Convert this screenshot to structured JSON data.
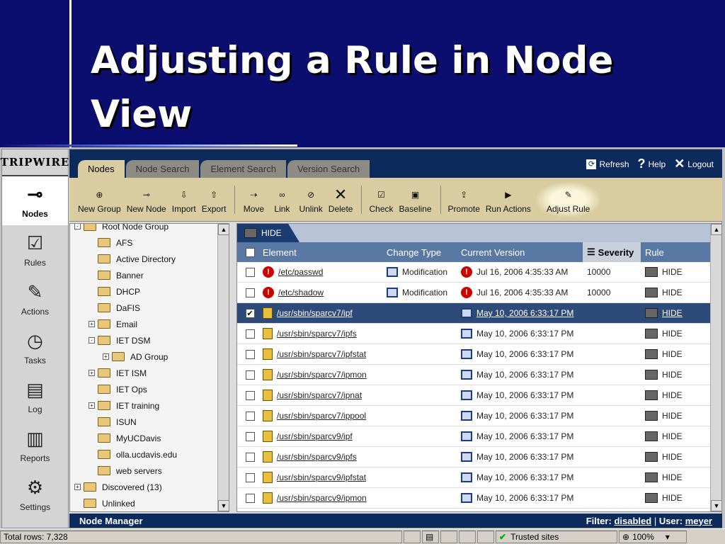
{
  "slide": {
    "title_line1": "Adjusting a Rule in Node",
    "title_line2": "View"
  },
  "app": {
    "brand": "TRIPWIRE",
    "rail": [
      {
        "label": "Nodes",
        "icon": "nodes-icon",
        "active": true
      },
      {
        "label": "Rules",
        "icon": "rules-icon"
      },
      {
        "label": "Actions",
        "icon": "actions-icon"
      },
      {
        "label": "Tasks",
        "icon": "tasks-icon"
      },
      {
        "label": "Log",
        "icon": "log-icon"
      },
      {
        "label": "Reports",
        "icon": "reports-icon"
      },
      {
        "label": "Settings",
        "icon": "settings-icon"
      }
    ],
    "tabs": [
      "Nodes",
      "Node Search",
      "Element Search",
      "Version Search"
    ],
    "toplinks": {
      "refresh": "Refresh",
      "help": "Help",
      "logout": "Logout"
    },
    "toolbar": {
      "new_group": "New Group",
      "new_node": "New Node",
      "import": "Import",
      "export": "Export",
      "move": "Move",
      "link": "Link",
      "unlink": "Unlink",
      "delete": "Delete",
      "check": "Check",
      "baseline": "Baseline",
      "promote": "Promote",
      "run_actions": "Run Actions",
      "adjust_rule": "Adjust Rule"
    },
    "tree": {
      "root": "Root Node Group",
      "items": [
        {
          "label": "AFS",
          "indent": 1
        },
        {
          "label": "Active Directory",
          "indent": 1
        },
        {
          "label": "Banner",
          "indent": 1
        },
        {
          "label": "DHCP",
          "indent": 1
        },
        {
          "label": "DaFIS",
          "indent": 1
        },
        {
          "label": "Email",
          "indent": 1,
          "expander": "+"
        },
        {
          "label": "IET DSM",
          "indent": 1,
          "expander": "-"
        },
        {
          "label": "AD Group",
          "indent": 2,
          "expander": "+"
        },
        {
          "label": "IET ISM",
          "indent": 1,
          "expander": "+"
        },
        {
          "label": "IET Ops",
          "indent": 1
        },
        {
          "label": "IET training",
          "indent": 1,
          "expander": "+"
        },
        {
          "label": "ISUN",
          "indent": 1
        },
        {
          "label": "MyUCDavis",
          "indent": 1
        },
        {
          "label": "olla.ucdavis.edu",
          "indent": 1
        },
        {
          "label": "web servers",
          "indent": 1
        },
        {
          "label": "Discovered (13)",
          "indent": 0,
          "expander": "+"
        },
        {
          "label": "Unlinked",
          "indent": 0
        }
      ]
    },
    "grid": {
      "tab": "HIDE",
      "headers": {
        "element": "Element",
        "change_type": "Change Type",
        "current_version": "Current Version",
        "severity": "Severity",
        "rule": "Rule"
      },
      "rows": [
        {
          "element": "/etc/passwd",
          "change": "Modification",
          "version": "Jul 16, 2006 4:35:33 AM",
          "severity": "10000",
          "rule": "HIDE",
          "alert": true,
          "checked": false
        },
        {
          "element": "/etc/shadow",
          "change": "Modification",
          "version": "Jul 16, 2006 4:35:33 AM",
          "severity": "10000",
          "rule": "HIDE",
          "alert": true,
          "checked": false
        },
        {
          "element": "/usr/sbin/sparcv7/ipf",
          "change": "",
          "version": "May 10, 2006 6:33:17 PM",
          "severity": "",
          "rule": "HIDE",
          "alert": false,
          "checked": true,
          "selected": true
        },
        {
          "element": "/usr/sbin/sparcv7/ipfs",
          "change": "",
          "version": "May 10, 2006 6:33:17 PM",
          "severity": "",
          "rule": "HIDE"
        },
        {
          "element": "/usr/sbin/sparcv7/ipfstat",
          "change": "",
          "version": "May 10, 2006 6:33:17 PM",
          "severity": "",
          "rule": "HIDE"
        },
        {
          "element": "/usr/sbin/sparcv7/ipmon",
          "change": "",
          "version": "May 10, 2006 6:33:17 PM",
          "severity": "",
          "rule": "HIDE"
        },
        {
          "element": "/usr/sbin/sparcv7/ipnat",
          "change": "",
          "version": "May 10, 2006 6:33:17 PM",
          "severity": "",
          "rule": "HIDE"
        },
        {
          "element": "/usr/sbin/sparcv7/ippool",
          "change": "",
          "version": "May 10, 2006 6:33:17 PM",
          "severity": "",
          "rule": "HIDE"
        },
        {
          "element": "/usr/sbin/sparcv9/ipf",
          "change": "",
          "version": "May 10, 2006 6:33:17 PM",
          "severity": "",
          "rule": "HIDE"
        },
        {
          "element": "/usr/sbin/sparcv9/ipfs",
          "change": "",
          "version": "May 10, 2006 6:33:17 PM",
          "severity": "",
          "rule": "HIDE"
        },
        {
          "element": "/usr/sbin/sparcv9/ipfstat",
          "change": "",
          "version": "May 10, 2006 6:33:17 PM",
          "severity": "",
          "rule": "HIDE"
        },
        {
          "element": "/usr/sbin/sparcv9/ipmon",
          "change": "",
          "version": "May 10, 2006 6:33:17 PM",
          "severity": "",
          "rule": "HIDE"
        }
      ]
    },
    "status": {
      "title": "Node Manager",
      "filter_label": "Filter:",
      "filter_value": "disabled",
      "user_label": "User:",
      "user_value": "meyer"
    }
  },
  "browser_status": {
    "total_rows": "Total rows: 7,328",
    "zone": "Trusted sites",
    "zoom": "100%"
  },
  "colors": {
    "slide_bg": "#0b0e6e",
    "toolbar_bg": "#d8cca0",
    "header_bg": "#5a78a4",
    "selected_row": "#2e4a78"
  }
}
